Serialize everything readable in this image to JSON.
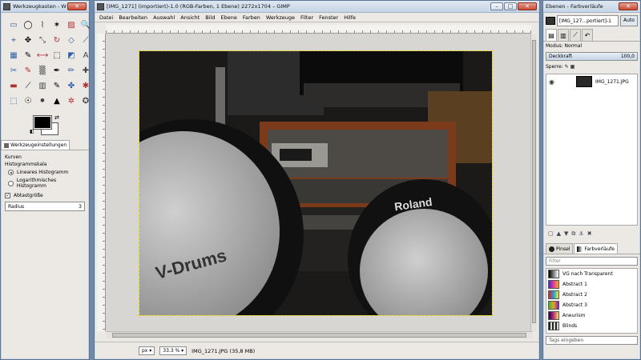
{
  "toolbox": {
    "title": "Werkzeugkasten - Werkzeugk...",
    "tools": [
      "▭",
      "◯",
      "⌇",
      "✶",
      "▨",
      "🔍",
      "⌖",
      "✥",
      "⤡",
      "↻",
      "◇",
      "⟋",
      "▦",
      "✎",
      "⟷",
      "⬚",
      "◩",
      "A",
      "✂",
      "✎",
      "▒",
      "✒",
      "✏",
      "✚",
      "▬",
      "⟋",
      "▥",
      "✎",
      "✤",
      "✱",
      "⬚",
      "☉",
      "⚫",
      "▲",
      "✲",
      "✪"
    ],
    "colors": {
      "fg": "#000000",
      "bg": "#ffffff"
    },
    "options_tab": "Werkzeugeinstellungen",
    "tool_name": "Kurven",
    "histogram_label": "Histogrammskala",
    "histogram_linear": "Lineares Histogramm",
    "histogram_log": "Logarithmisches Histogramm",
    "sample_average": "Abtastgröße",
    "radius_label": "Radius",
    "radius_value": "3"
  },
  "image_window": {
    "title": "[IMG_1271] (importiert)-1.0 (RGB-Farben, 1 Ebene) 2272x1704 – GIMP",
    "menu": [
      "Datei",
      "Bearbeiten",
      "Auswahl",
      "Ansicht",
      "Bild",
      "Ebene",
      "Farben",
      "Werkzeuge",
      "Filter",
      "Fenster",
      "Hilfe"
    ],
    "unit": "px",
    "zoom": "33.3 %",
    "status": "IMG_1271.JPG (35,8 MB)",
    "photo_brand": "Roland"
  },
  "dock": {
    "title": "Ebenen - Farbverläufe",
    "image_selector": "[IMG_127...portiert]-1",
    "auto_label": "Auto",
    "mode_label": "Modus:",
    "mode_value": "Normal",
    "opacity_label": "Deckkraft",
    "opacity_value": "100,0",
    "lock_label": "Sperre:",
    "layer_name": "IMG_1271.JPG",
    "tab_brush": "Pinsel",
    "tab_gradients": "Farbverläufe",
    "filter_placeholder": "Filter",
    "gradients": [
      {
        "name": "VG nach Transparent",
        "colors": "linear-gradient(90deg,#000,rgba(0,0,0,0))"
      },
      {
        "name": "Abstract 1",
        "colors": "linear-gradient(90deg,#3a2be0,#f03a8a,#e8b030)"
      },
      {
        "name": "Abstract 2",
        "colors": "linear-gradient(90deg,#e02020,#20a0e0,#f0f020)"
      },
      {
        "name": "Abstract 3",
        "colors": "linear-gradient(90deg,#30c030,#f0a020,#8020c0)"
      },
      {
        "name": "Aneurism",
        "colors": "linear-gradient(90deg,#200040,#c03080,#f0e060)"
      },
      {
        "name": "Blinds",
        "colors": "repeating-linear-gradient(90deg,#222 0 2px,#ddd 2px 4px)"
      }
    ],
    "tag_placeholder": "Tags eingeben"
  }
}
